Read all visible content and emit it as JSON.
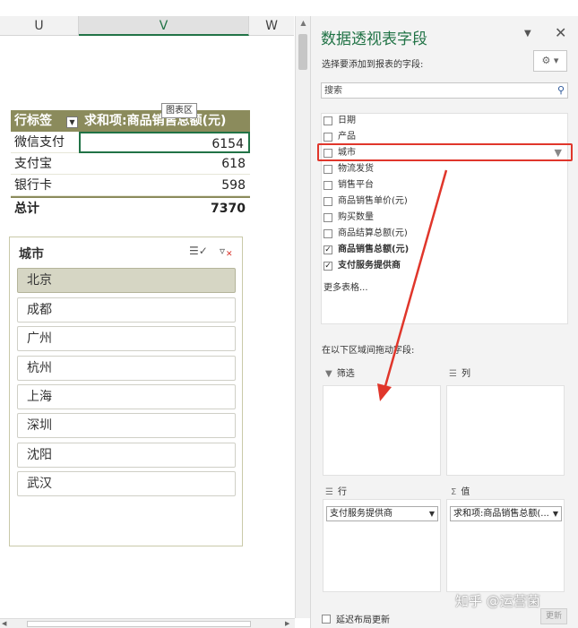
{
  "sheet": {
    "columns": [
      "U",
      "V",
      "W"
    ],
    "selected_column": "V",
    "chart_area_tooltip": "图表区",
    "pivot": {
      "header": [
        "行标签",
        "求和项:商品销售总额(元)"
      ],
      "rows": [
        {
          "label": "微信支付",
          "value": "6154"
        },
        {
          "label": "支付宝",
          "value": "618"
        },
        {
          "label": "银行卡",
          "value": "598"
        }
      ],
      "total": {
        "label": "总计",
        "value": "7370"
      }
    },
    "slicer": {
      "title": "城市",
      "multiselect_icon": "multiselect-icon",
      "clear_filter_icon": "clear-filter-icon",
      "items": [
        "北京",
        "成都",
        "广州",
        "杭州",
        "上海",
        "深圳",
        "沈阳",
        "武汉"
      ],
      "selected": "北京"
    }
  },
  "panel": {
    "title": "数据透视表字段",
    "subtitle": "选择要添加到报表的字段:",
    "search": {
      "placeholder": "搜索",
      "icon": "search-icon"
    },
    "fields": [
      {
        "label": "日期",
        "checked": false
      },
      {
        "label": "产品",
        "checked": false
      },
      {
        "label": "城市",
        "checked": false,
        "filtered": true,
        "highlighted": true
      },
      {
        "label": "物流发货",
        "checked": false
      },
      {
        "label": "销售平台",
        "checked": false
      },
      {
        "label": "商品销售单价(元)",
        "checked": false
      },
      {
        "label": "购买数量",
        "checked": false
      },
      {
        "label": "商品结算总额(元)",
        "checked": false
      },
      {
        "label": "商品销售总额(元)",
        "checked": true
      },
      {
        "label": "支付服务提供商",
        "checked": true
      }
    ],
    "more_tables": "更多表格...",
    "drag_hint": "在以下区域间拖动字段:",
    "areas": {
      "filters": {
        "label": "筛选",
        "icon": "filter-icon",
        "items": []
      },
      "columns": {
        "label": "列",
        "icon": "columns-icon",
        "items": []
      },
      "rows": {
        "label": "行",
        "icon": "rows-icon",
        "items": [
          "支付服务提供商"
        ]
      },
      "values": {
        "label": "值",
        "icon": "sigma-icon",
        "items": [
          "求和项:商品销售总额(..."
        ]
      }
    },
    "defer_update_label": "延迟布局更新",
    "update_button": "更新"
  },
  "annotation": {
    "arrow_color": "#e0362b",
    "highlight_color": "#e0362b"
  },
  "watermark": "知乎 @运营菌",
  "colors": {
    "accent_green": "#217346",
    "pivot_header": "#8b8b5c",
    "slicer_selected": "#d6d6c4"
  }
}
